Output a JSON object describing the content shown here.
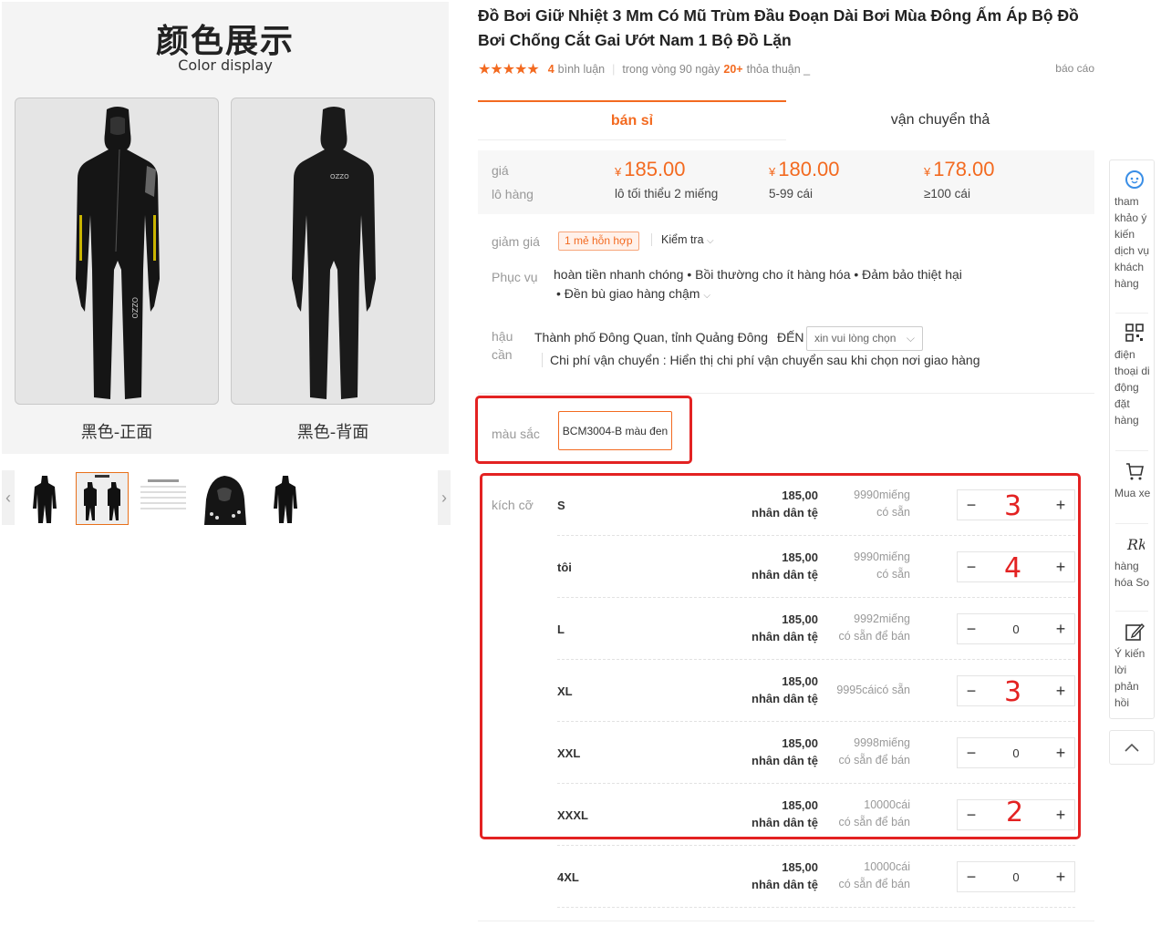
{
  "gallery": {
    "banner_title": "颜色展示",
    "banner_subtitle": "Color display",
    "front_caption": "黑色-正面",
    "back_caption": "黑色-背面",
    "suit_logo": "OZZO"
  },
  "product": {
    "title": "Đồ Bơi Giữ Nhiệt 3 Mm Có Mũ Trùm Đầu Đoạn Dài Bơi Mùa Đông Ấm Áp Bộ Đồ Bơi Chống Cắt Gai Ướt Nam 1 Bộ Đồ Lặn",
    "rating_count": "4",
    "rating_label": "bình luận",
    "deal_prefix": "trong vòng 90 ngày",
    "deal_count": "20+",
    "deal_suffix": "thỏa thuận _",
    "report": "báo cáo"
  },
  "tabs": [
    "bán sỉ",
    "vận chuyển thả"
  ],
  "pricing": {
    "label_price": "giá",
    "label_batch": "lô hàng",
    "currency": "¥",
    "tiers": [
      {
        "price": "185.00",
        "qty": "lô tối thiểu 2 miếng"
      },
      {
        "price": "180.00",
        "qty": "5-99 cái"
      },
      {
        "price": "178.00",
        "qty": "≥100 cái"
      }
    ]
  },
  "discount": {
    "label": "giảm giá",
    "tag": "1 mẻ hỗn hợp",
    "check": "Kiểm tra"
  },
  "service": {
    "label": "Phục vụ",
    "line1": "hoàn tiền nhanh chóng • Bồi thường cho ít hàng hóa • Đảm bảo thiệt hại",
    "line2": "• Đền bù giao hàng chậm"
  },
  "logistics": {
    "label1": "hậu",
    "label2": "cần",
    "origin": "Thành phố Đông Quan, tỉnh Quảng Đông",
    "to": "ĐẾN",
    "dest_placeholder": "xin vui lòng chọn",
    "shipping_note": "Chi phí vận chuyển : Hiển thị chi phí vận chuyển sau khi chọn nơi giao hàng"
  },
  "color": {
    "label": "màu sắc",
    "option": "BCM3004-B màu đen"
  },
  "size": {
    "label": "kích cỡ",
    "currency_text": "nhân dân tệ",
    "rows": [
      {
        "name": "S",
        "price": "185,00",
        "stock1": "9990miếng",
        "stock2": "có sẵn",
        "qty": "3",
        "annotated": true
      },
      {
        "name": "tôi",
        "price": "185,00",
        "stock1": "9990miếng",
        "stock2": "có sẵn",
        "qty": "4",
        "annotated": true
      },
      {
        "name": "L",
        "price": "185,00",
        "stock1": "9992miếng",
        "stock2": "có sẵn để bán",
        "qty": "0",
        "annotated": false
      },
      {
        "name": "XL",
        "price": "185,00",
        "stock1": "9995cáicó sẵn",
        "stock2": "",
        "qty": "3",
        "annotated": true
      },
      {
        "name": "XXL",
        "price": "185,00",
        "stock1": "9998miếng",
        "stock2": "có sẵn để bán",
        "qty": "0",
        "annotated": false
      },
      {
        "name": "XXXL",
        "price": "185,00",
        "stock1": "10000cái",
        "stock2": "có sẵn để bán",
        "qty": "2",
        "annotated": true
      },
      {
        "name": "4XL",
        "price": "185,00",
        "stock1": "10000cái",
        "stock2": "có sẵn để bán",
        "qty": "0",
        "annotated": false
      }
    ]
  },
  "toolbar": {
    "feedback_customer": "tham khảo ý kiến dịch vụ khách hàng",
    "mobile_order": "điện thoại di động đặt hàng",
    "cart": "Mua xe",
    "compare": "hàng hóa So",
    "feedback": "Ý kiến lời phản hồi"
  },
  "colors": {
    "accent": "#f36a20",
    "annotation_red": "#e32222"
  }
}
